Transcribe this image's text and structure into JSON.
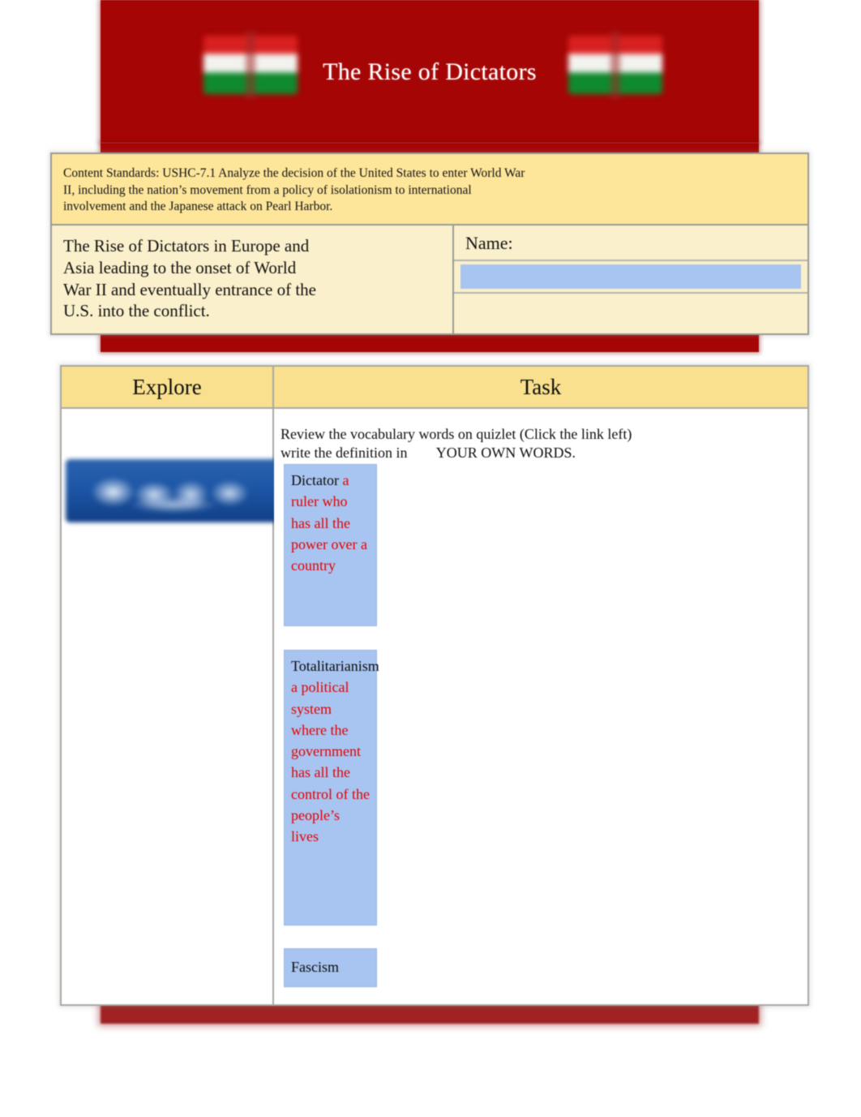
{
  "document": {
    "title": "The Rise of Dictators"
  },
  "header": {
    "title": "The Rise of Dictators",
    "flag_left": "hungary-flag-icon",
    "flag_right": "hungary-flag-icon",
    "banner_color": "#a50505",
    "title_color": "#ffffff"
  },
  "standards": {
    "line1": "Content Standards: USHC-7.1 Analyze the decision of the United States to enter World War",
    "line2": "II, including the nation’s movement from a policy of isolationism to international",
    "line3": "involvement and the Japanese attack on Pearl Harbor.",
    "background": "#fde59a"
  },
  "description": {
    "line1": "The Rise of Dictators in Europe and",
    "line2": "Asia leading to the onset of World",
    "line3": "War II and eventually entrance of the",
    "line4": "U.S. into the conflict.",
    "background": "#fbf0cc"
  },
  "name_field": {
    "label": "Name:",
    "value": "",
    "placeholder": "",
    "field_color": "#a8c4f0"
  },
  "work_table": {
    "explore_header": "Explore",
    "task_header": "Task",
    "header_color": "#f8e08e",
    "explore": {
      "quizlet_logo_label": "Quizlet",
      "logo_color": "#1d56a6"
    },
    "task": {
      "instructions_line1": "Review the vocabulary words on quizlet (Click the link left)",
      "instructions_line2": "write the definition in        YOUR OWN WORDS."
    },
    "vocabulary": [
      {
        "term": "Dictator",
        "definition": " a ruler who has all the power over a country",
        "term_color": "#0d0d0d",
        "definition_color": "#e60000"
      },
      {
        "term": "Totalitarianism",
        "definition": " a political system where the government has all the control of the people’s lives",
        "term_color": "#0d0d0d",
        "definition_color": "#e60000"
      },
      {
        "term": "Fascism",
        "definition": "",
        "term_color": "#0d0d0d",
        "definition_color": "#e60000"
      }
    ]
  }
}
